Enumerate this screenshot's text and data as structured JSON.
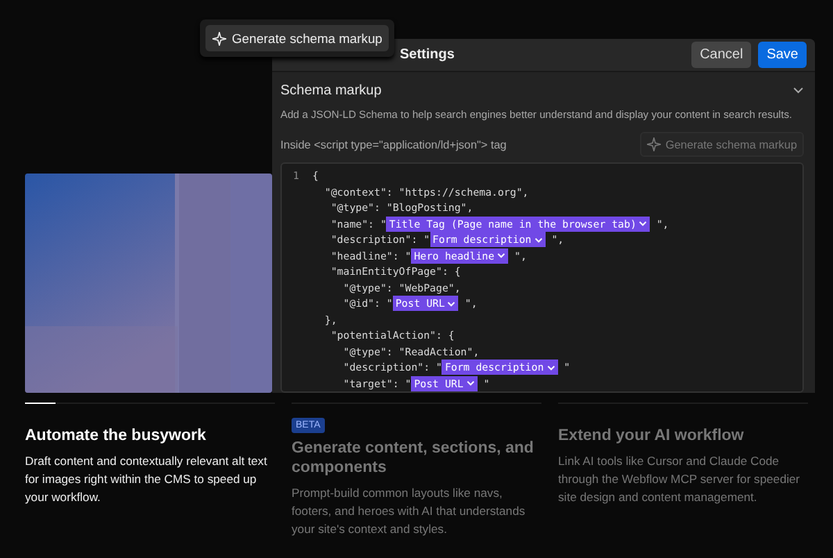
{
  "popup": {
    "label": "Generate schema markup"
  },
  "panel": {
    "title": "Settings",
    "buttons": [
      {
        "label": "Cancel",
        "kind": "secondary"
      },
      {
        "label": "Save",
        "kind": "primary"
      }
    ],
    "section": {
      "title": "Schema markup",
      "expanded": true,
      "description": "Add a JSON-LD Schema to help search engines better understand and display your content in search results.",
      "editor_label": "Inside <script type=\"application/ld+json\"> tag",
      "generate_button": "Generate schema markup",
      "code_lines": [
        {
          "line_number": "1",
          "parts": [
            {
              "kind": "code",
              "text": "{"
            }
          ]
        },
        {
          "parts": [
            {
              "kind": "code",
              "text": "  \"@context\": \"https://schema.org\","
            }
          ]
        },
        {
          "parts": [
            {
              "kind": "code",
              "text": "   \"@type\": \"BlogPosting\","
            }
          ]
        },
        {
          "parts": [
            {
              "kind": "code",
              "text": "   \"name\": \""
            },
            {
              "kind": "token",
              "text": "Title Tag (Page name in the browser tab)"
            },
            {
              "kind": "code",
              "text": " \","
            }
          ]
        },
        {
          "parts": [
            {
              "kind": "code",
              "text": "   \"description\": \""
            },
            {
              "kind": "token",
              "text": "Form description"
            },
            {
              "kind": "code",
              "text": " \","
            }
          ]
        },
        {
          "parts": [
            {
              "kind": "code",
              "text": "   \"headline\": \""
            },
            {
              "kind": "token",
              "text": "Hero headline"
            },
            {
              "kind": "code",
              "text": " \","
            }
          ]
        },
        {
          "parts": [
            {
              "kind": "code",
              "text": "   \"mainEntityOfPage\": {"
            }
          ]
        },
        {
          "parts": [
            {
              "kind": "code",
              "text": "     \"@type\": \"WebPage\","
            }
          ]
        },
        {
          "parts": [
            {
              "kind": "code",
              "text": "     \"@id\": \""
            },
            {
              "kind": "token",
              "text": "Post URL"
            },
            {
              "kind": "code",
              "text": " \","
            }
          ]
        },
        {
          "parts": [
            {
              "kind": "code",
              "text": "  },"
            }
          ]
        },
        {
          "parts": [
            {
              "kind": "code",
              "text": "   \"potentialAction\": {"
            }
          ]
        },
        {
          "parts": [
            {
              "kind": "code",
              "text": "     \"@type\": \"ReadAction\","
            }
          ]
        },
        {
          "parts": [
            {
              "kind": "code",
              "text": "     \"description\": \""
            },
            {
              "kind": "token",
              "text": "Form description"
            },
            {
              "kind": "code",
              "text": " \""
            }
          ]
        },
        {
          "parts": [
            {
              "kind": "code",
              "text": "     \"target\": \""
            },
            {
              "kind": "token",
              "text": "Post URL"
            },
            {
              "kind": "code",
              "text": " \""
            }
          ]
        }
      ]
    }
  },
  "features": [
    {
      "title": "Automate the busywork",
      "selected": true,
      "body": "Draft content and contextually relevant alt text for images right within the CMS to speed up your workflow."
    },
    {
      "badge": "BETA",
      "title": "Generate content, sections, and components",
      "selected": false,
      "body": "Prompt-build common layouts like navs, footers, and heroes with AI that understands your site's context and styles."
    },
    {
      "title": "Extend your AI workflow",
      "selected": false,
      "body": "Link AI tools like Cursor and Claude Code through the Webflow MCP server for speedier site design and content management."
    }
  ]
}
